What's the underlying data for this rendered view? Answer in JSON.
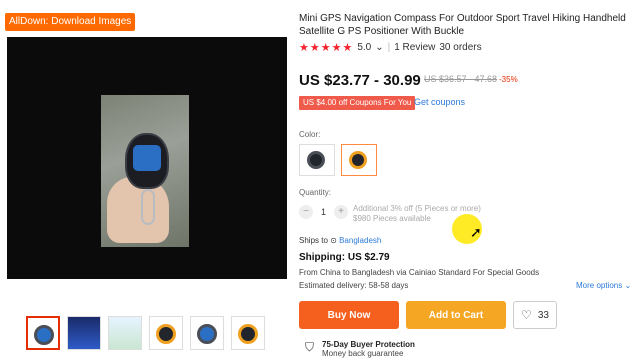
{
  "extension": {
    "badge_label": "AllDown: Download Images"
  },
  "product": {
    "title": "Mini GPS Navigation Compass For Outdoor Sport Travel Hiking Handheld Satellite G PS Positioner With Buckle",
    "rating": {
      "stars": "★★★★★",
      "score": "5.0",
      "chevron": "⌄",
      "reviews": "1 Review",
      "orders": "30 orders"
    },
    "price": {
      "range": "US $23.77 - 30.99",
      "original": "US $36.57 - 47.68",
      "discount": "-35%"
    },
    "coupon": {
      "badge": "US $4.00 off Coupons For You",
      "link": "Get coupons"
    },
    "color_label": "Color:",
    "quantity": {
      "label": "Quantity:",
      "value": "1",
      "minus": "−",
      "plus": "+",
      "additional": "Additional 3% off (5 Pieces or more)",
      "available": "$980 Pieces available"
    },
    "ships_to": {
      "label": "Ships to",
      "pin": "⊙",
      "destination": "Bangladesh"
    },
    "shipping": {
      "cost": "Shipping: US $2.79",
      "route": "From China to Bangladesh via Cainiao Standard For Special Goods",
      "delivery": "Estimated delivery: 58-58 days",
      "more_options": "More options ⌄"
    },
    "actions": {
      "buy_now": "Buy Now",
      "add_to_cart": "Add to Cart",
      "wishlist_count": "33",
      "heart": "♡"
    },
    "protection": {
      "title": "75-Day Buyer Protection",
      "subtitle": "Money back guarantee",
      "icon": "⛉"
    }
  },
  "icons": [
    "play-video",
    "gps-device",
    "heart-icon",
    "shield-icon",
    "location-pin-icon"
  ],
  "colors": {
    "accent": "#ff6a00",
    "buy": "#f5601e",
    "cart": "#f5a623",
    "link": "#2e7bd8",
    "price_red": "#e62e04"
  }
}
